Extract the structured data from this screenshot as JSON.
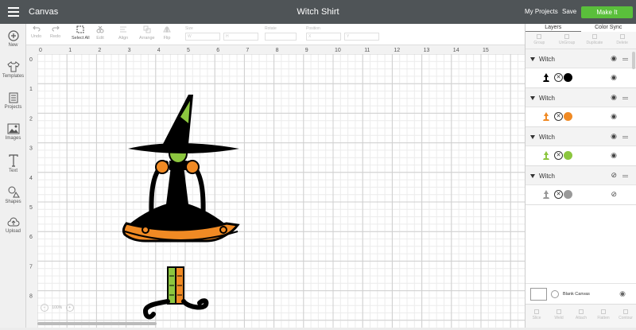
{
  "header": {
    "app": "Canvas",
    "title": "Witch Shirt",
    "my_projects": "My Projects",
    "save": "Save",
    "make_it": "Make It"
  },
  "sidebar": [
    {
      "label": "New",
      "icon": "plus-circle-icon"
    },
    {
      "label": "Templates",
      "icon": "shirt-icon"
    },
    {
      "label": "Projects",
      "icon": "projects-icon"
    },
    {
      "label": "Images",
      "icon": "image-icon"
    },
    {
      "label": "Text",
      "icon": "text-icon"
    },
    {
      "label": "Shapes",
      "icon": "shapes-icon"
    },
    {
      "label": "Upload",
      "icon": "upload-icon"
    }
  ],
  "toolbar": {
    "undo": "Undo",
    "redo": "Redo",
    "select_all": "Select All",
    "edit": "Edit",
    "align": "Align",
    "arrange": "Arrange",
    "flip": "Flip",
    "size": "Size",
    "w": "W",
    "h": "H",
    "rotate": "Rotate",
    "position": "Position",
    "x": "X",
    "y": "Y"
  },
  "ruler": {
    "top": [
      "0",
      "1",
      "2",
      "3",
      "4",
      "5",
      "6",
      "7",
      "8",
      "9",
      "10",
      "11",
      "12",
      "13",
      "14",
      "15"
    ],
    "left": [
      "0",
      "1",
      "2",
      "3",
      "4",
      "5",
      "6",
      "7",
      "8"
    ]
  },
  "zoom": "100%",
  "panel": {
    "tabs": [
      "Layers",
      "Color Sync"
    ],
    "tools": [
      "Group",
      "UnGroup",
      "Duplicate",
      "Delete"
    ],
    "layers": [
      {
        "name": "Witch",
        "color": "#000000",
        "visible": true
      },
      {
        "name": "Witch",
        "color": "#f08a24",
        "visible": true
      },
      {
        "name": "Witch",
        "color": "#8cc63f",
        "visible": true
      },
      {
        "name": "Witch",
        "color": "#999999",
        "visible": false
      }
    ],
    "blank_canvas": "Blank Canvas",
    "bottom_tools": [
      "Slice",
      "Weld",
      "Attach",
      "Flatten",
      "Contour"
    ]
  }
}
